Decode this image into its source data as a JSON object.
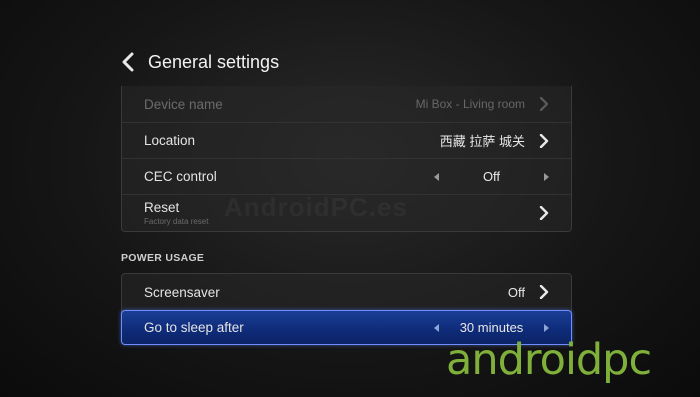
{
  "header": {
    "title": "General settings",
    "back_icon": "chevron-left-icon"
  },
  "general": {
    "device_name": {
      "label": "Device name",
      "value": "Mi Box - Living room"
    },
    "location": {
      "label": "Location",
      "value": "西藏 拉萨 城关"
    },
    "cec_control": {
      "label": "CEC control",
      "value": "Off"
    },
    "reset": {
      "label": "Reset",
      "subtitle": "Factory data reset"
    }
  },
  "power_usage": {
    "header": "POWER USAGE",
    "screensaver": {
      "label": "Screensaver",
      "value": "Off"
    },
    "sleep": {
      "label": "Go to sleep after",
      "value": "30 minutes"
    }
  },
  "watermark": "AndroidPC.es",
  "brand_logo": "androidpc",
  "colors": {
    "selection": "#1b3e95",
    "selection_border": "#6f8dff",
    "logo": "#7fb03a"
  }
}
